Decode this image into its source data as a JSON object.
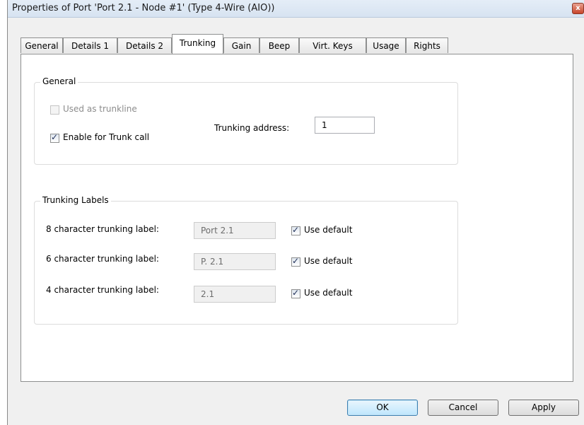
{
  "window": {
    "title": "Properties of Port 'Port 2.1 - Node #1' (Type 4-Wire (AIO))",
    "close_glyph": "x"
  },
  "tabs": [
    {
      "label": "General",
      "active": false
    },
    {
      "label": "Details 1",
      "active": false
    },
    {
      "label": "Details 2",
      "active": false
    },
    {
      "label": "Trunking",
      "active": true
    },
    {
      "label": "Gain",
      "active": false
    },
    {
      "label": "Beep",
      "active": false
    },
    {
      "label": "Virt. Keys",
      "active": false
    },
    {
      "label": "Usage",
      "active": false
    },
    {
      "label": "Rights",
      "active": false
    }
  ],
  "general_group": {
    "title": "General",
    "used_as_trunkline": {
      "label": "Used as trunkline",
      "checked": false,
      "disabled": true
    },
    "enable_trunk_call": {
      "label": "Enable for Trunk call",
      "checked": true
    },
    "trunking_address": {
      "label": "Trunking address:",
      "value": "1"
    }
  },
  "labels_group": {
    "title": "Trunking Labels",
    "rows": [
      {
        "label": "8 character trunking label:",
        "value": "Port 2.1",
        "use_default_label": "Use default",
        "use_default": true
      },
      {
        "label": "6 character trunking label:",
        "value": "P. 2.1",
        "use_default_label": "Use default",
        "use_default": true
      },
      {
        "label": "4 character trunking label:",
        "value": "2.1",
        "use_default_label": "Use default",
        "use_default": true
      }
    ]
  },
  "buttons": {
    "ok": "OK",
    "cancel": "Cancel",
    "apply": "Apply"
  }
}
